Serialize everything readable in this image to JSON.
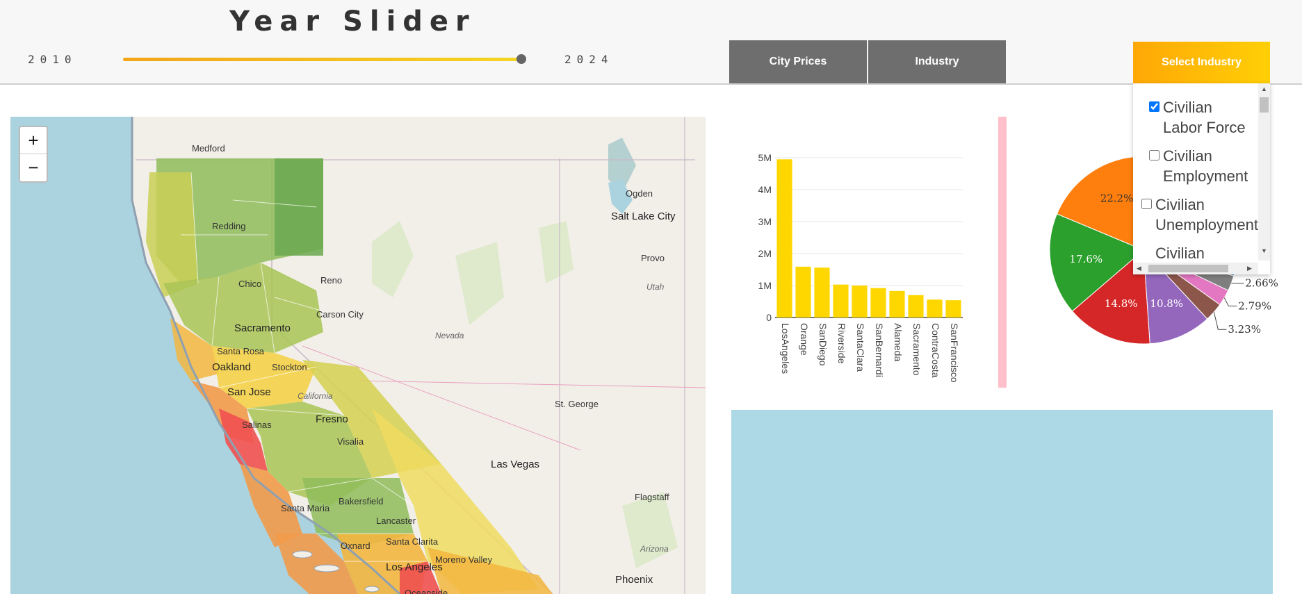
{
  "header": {
    "title": "Year Slider",
    "slider": {
      "min_label": "2010",
      "max_label": "2024",
      "value_fraction": 1.0
    },
    "tabs": [
      {
        "label": "City Prices"
      },
      {
        "label": "Industry"
      }
    ],
    "select_button": "Select Industry"
  },
  "dropdown": {
    "items": [
      {
        "line1": "Civilian",
        "line2": "Labor Force",
        "checked": true
      },
      {
        "line1": "Civilian",
        "line2": "Employment",
        "checked": false
      },
      {
        "line1": "Civilian",
        "line2": "Unemployment",
        "checked": false
      },
      {
        "line1": "Civilian",
        "line2": "",
        "checked": false
      }
    ]
  },
  "map": {
    "zoom_in": "+",
    "zoom_out": "−",
    "labels": {
      "medford": "Medford",
      "ogden": "Ogden",
      "salt_lake_city": "Salt Lake City",
      "provo": "Provo",
      "utah": "Utah",
      "redding": "Redding",
      "chico": "Chico",
      "reno": "Reno",
      "carson_city": "Carson City",
      "sacramento": "Sacramento",
      "santa_rosa": "Santa Rosa",
      "oakland": "Oakland",
      "stockton": "Stockton",
      "san_jose": "San Jose",
      "california": "California",
      "nevada": "Nevada",
      "salinas": "Salinas",
      "fresno": "Fresno",
      "visalia": "Visalia",
      "st_george": "St. George",
      "las_vegas": "Las Vegas",
      "bakersfield": "Bakersfield",
      "santa_maria": "Santa Maria",
      "lancaster": "Lancaster",
      "flagstaff": "Flagstaff",
      "oxnard": "Oxnard",
      "santa_clarita": "Santa Clarita",
      "moreno_valley": "Moreno Valley",
      "arizona": "Arizona",
      "los_angeles": "Los Angeles",
      "phoenix": "Phoenix",
      "oceanside": "Oceanside"
    }
  },
  "chart_data": [
    {
      "type": "bar",
      "title": "",
      "categories": [
        "LosAngeles",
        "Orange",
        "SanDiego",
        "Riverside",
        "SantaClara",
        "SanBernardi",
        "Alameda",
        "Sacramento",
        "ContraCosta",
        "SanFrancisco"
      ],
      "values": [
        4950000,
        1590000,
        1560000,
        1030000,
        1000000,
        920000,
        830000,
        700000,
        560000,
        540000
      ],
      "ylim": [
        0,
        5000000
      ],
      "yticks": [
        "0",
        "1M",
        "2M",
        "3M",
        "4M",
        "5M"
      ],
      "color": "#ffd700",
      "grid": true
    },
    {
      "type": "pie",
      "slices": [
        {
          "label": "22.2%",
          "value": 22.2,
          "color": "#ff7f0e"
        },
        {
          "label": "17.6%",
          "value": 17.6,
          "color": "#2ca02c"
        },
        {
          "label": "14.8%",
          "value": 14.8,
          "color": "#d62728"
        },
        {
          "label": "10.8%",
          "value": 10.8,
          "color": "#9467bd"
        },
        {
          "label": "3.23%",
          "value": 3.23,
          "color": "#8c564b"
        },
        {
          "label": "2.79%",
          "value": 2.79,
          "color": "#e377c2"
        },
        {
          "label": "2.66%",
          "value": 2.66,
          "color": "#7f7f7f"
        },
        {
          "label": "",
          "value": 25.92,
          "color": "#1f77b4"
        }
      ]
    }
  ]
}
